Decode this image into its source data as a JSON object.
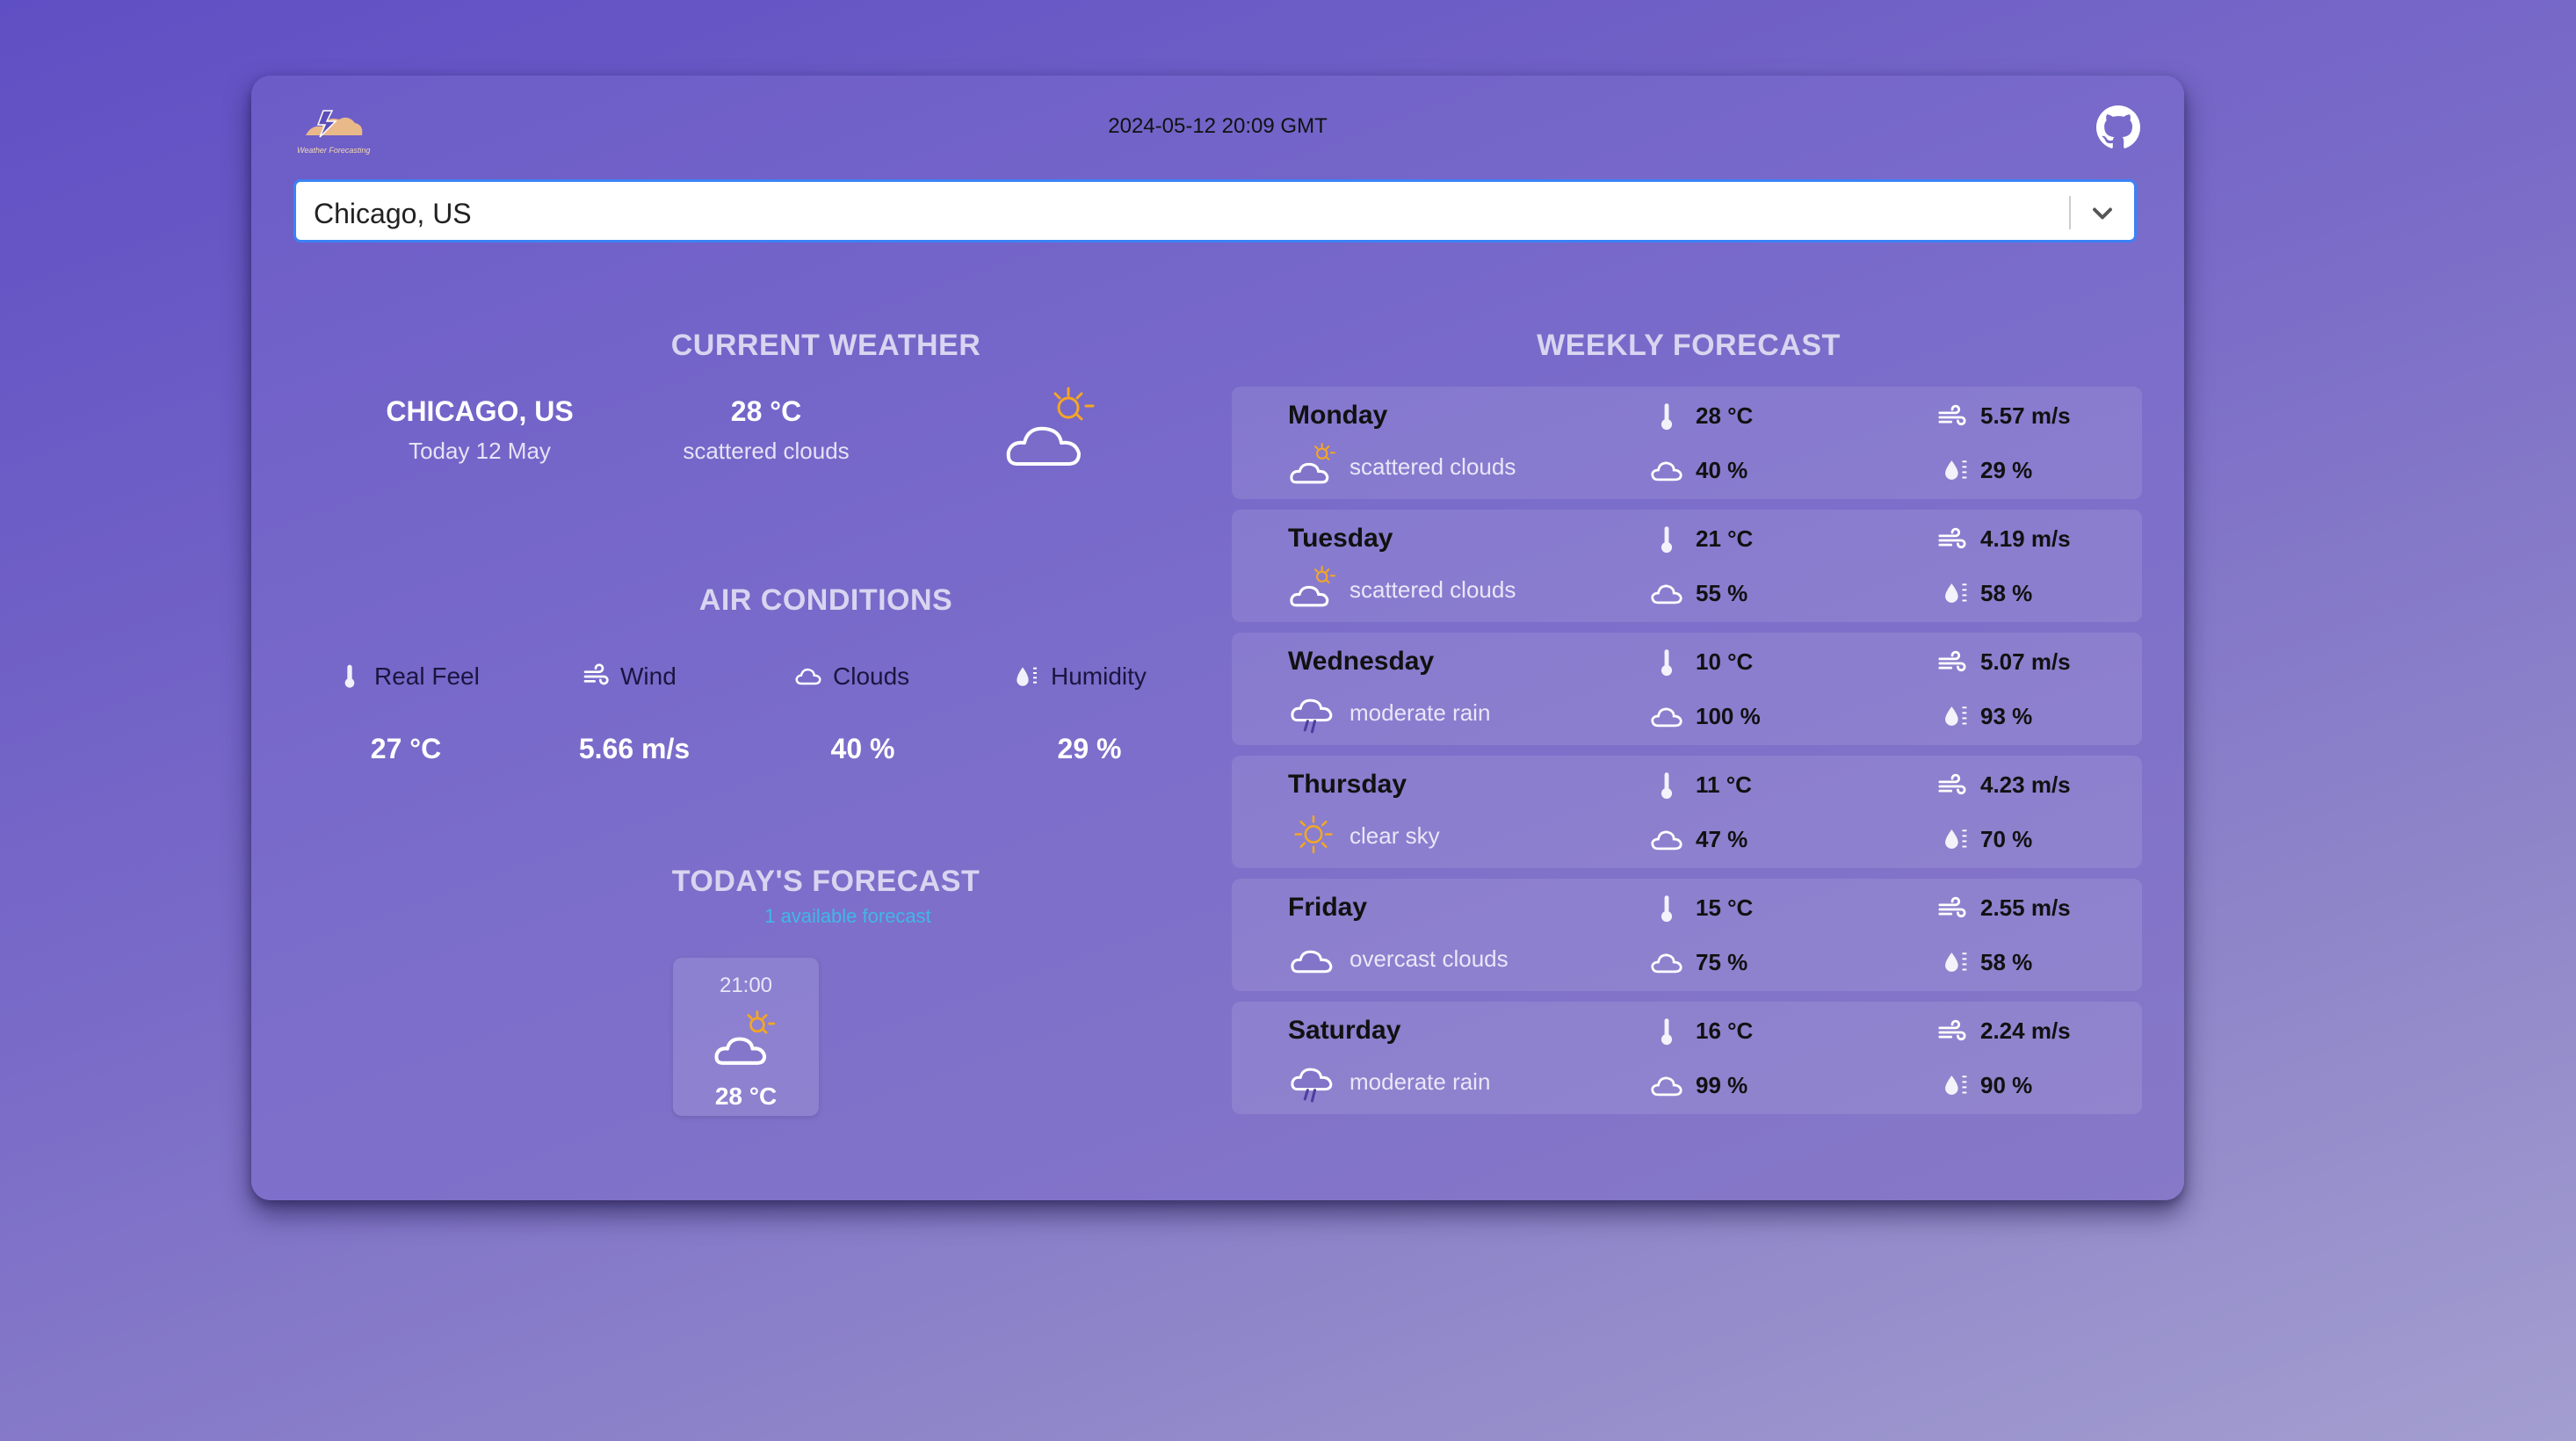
{
  "header": {
    "logo_text": "Weather Forecasting",
    "datetime": "2024-05-12 20:09 GMT"
  },
  "search": {
    "value": "Chicago, US"
  },
  "current": {
    "title": "CURRENT WEATHER",
    "city": "CHICAGO, US",
    "date": "Today 12 May",
    "temp": "28 °C",
    "desc": "scattered clouds",
    "icon": "partly-cloudy-icon"
  },
  "air": {
    "title": "AIR CONDITIONS",
    "real_feel_label": "Real Feel",
    "real_feel": "27 °C",
    "wind_label": "Wind",
    "wind": "5.66 m/s",
    "clouds_label": "Clouds",
    "clouds": "40 %",
    "humidity_label": "Humidity",
    "humidity": "29 %"
  },
  "today": {
    "title": "TODAY'S FORECAST",
    "available": "1 available forecast",
    "items": [
      {
        "time": "21:00",
        "temp": "28 °C",
        "icon": "partly-cloudy-icon"
      }
    ]
  },
  "weekly": {
    "title": "WEEKLY FORECAST",
    "days": [
      {
        "day": "Monday",
        "temp": "28 °C",
        "wind": "5.57 m/s",
        "desc": "scattered clouds",
        "clouds": "40 %",
        "humidity": "29 %",
        "icon": "partly-cloudy-icon"
      },
      {
        "day": "Tuesday",
        "temp": "21 °C",
        "wind": "4.19 m/s",
        "desc": "scattered clouds",
        "clouds": "55 %",
        "humidity": "58 %",
        "icon": "partly-cloudy-icon"
      },
      {
        "day": "Wednesday",
        "temp": "10 °C",
        "wind": "5.07 m/s",
        "desc": "moderate rain",
        "clouds": "100 %",
        "humidity": "93 %",
        "icon": "rain-icon"
      },
      {
        "day": "Thursday",
        "temp": "11 °C",
        "wind": "4.23 m/s",
        "desc": "clear sky",
        "clouds": "47 %",
        "humidity": "70 %",
        "icon": "sun-icon"
      },
      {
        "day": "Friday",
        "temp": "15 °C",
        "wind": "2.55 m/s",
        "desc": "overcast clouds",
        "clouds": "75 %",
        "humidity": "58 %",
        "icon": "cloud-icon"
      },
      {
        "day": "Saturday",
        "temp": "16 °C",
        "wind": "2.24 m/s",
        "desc": "moderate rain",
        "clouds": "99 %",
        "humidity": "90 %",
        "icon": "rain-icon"
      }
    ]
  },
  "colors": {
    "accent_blue": "#3b82f6",
    "sun": "#f5a623",
    "link_blue": "#41b7e6"
  }
}
